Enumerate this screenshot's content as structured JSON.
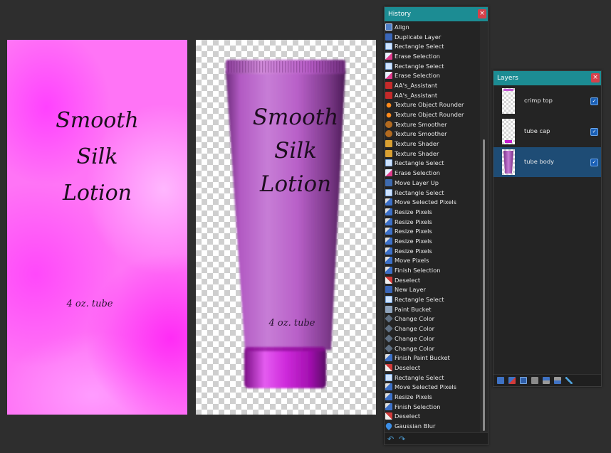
{
  "label_canvas": {
    "title": "Smooth\nSilk\nLotion",
    "size_text": "4 oz. tube"
  },
  "tube_canvas": {
    "title": "Smooth\nSilk\nLotion",
    "size_text": "4 oz. tube",
    "colors": {
      "tube": "#b554c4",
      "cap": "#c51bd0",
      "crimp": "#c15ad0"
    }
  },
  "history": {
    "title": "History",
    "close_symbol": "×",
    "undo_symbol": "↶",
    "redo_symbol": "↷",
    "items": [
      {
        "label": "Align",
        "icon": "align"
      },
      {
        "label": "Duplicate Layer",
        "icon": "dup"
      },
      {
        "label": "Rectangle Select",
        "icon": "rect"
      },
      {
        "label": "Erase Selection",
        "icon": "erase"
      },
      {
        "label": "Rectangle Select",
        "icon": "rect"
      },
      {
        "label": "Erase Selection",
        "icon": "erase"
      },
      {
        "label": "AA's_Assistant",
        "icon": "aa"
      },
      {
        "label": "AA's_Assistant",
        "icon": "aa"
      },
      {
        "label": "Texture Object Rounder",
        "icon": "rounder"
      },
      {
        "label": "Texture Object Rounder",
        "icon": "rounder"
      },
      {
        "label": "Texture Smoother",
        "icon": "smoother"
      },
      {
        "label": "Texture Smoother",
        "icon": "smoother"
      },
      {
        "label": "Texture Shader",
        "icon": "shader"
      },
      {
        "label": "Texture Shader",
        "icon": "shader"
      },
      {
        "label": "Rectangle Select",
        "icon": "rect"
      },
      {
        "label": "Erase Selection",
        "icon": "erase"
      },
      {
        "label": "Move Layer Up",
        "icon": "move"
      },
      {
        "label": "Rectangle Select",
        "icon": "rect"
      },
      {
        "label": "Move Selected Pixels",
        "icon": "arrow"
      },
      {
        "label": "Resize Pixels",
        "icon": "arrow"
      },
      {
        "label": "Resize Pixels",
        "icon": "arrow"
      },
      {
        "label": "Resize Pixels",
        "icon": "arrow"
      },
      {
        "label": "Resize Pixels",
        "icon": "arrow"
      },
      {
        "label": "Resize Pixels",
        "icon": "arrow"
      },
      {
        "label": "Move Pixels",
        "icon": "arrow"
      },
      {
        "label": "Finish Selection",
        "icon": "arrow"
      },
      {
        "label": "Deselect",
        "icon": "deselect"
      },
      {
        "label": "New Layer",
        "icon": "new"
      },
      {
        "label": "Rectangle Select",
        "icon": "rect"
      },
      {
        "label": "Paint Bucket",
        "icon": "bucket"
      },
      {
        "label": "Change Color",
        "icon": "color"
      },
      {
        "label": "Change Color",
        "icon": "color"
      },
      {
        "label": "Change Color",
        "icon": "color"
      },
      {
        "label": "Change Color",
        "icon": "color"
      },
      {
        "label": "Finish Paint Bucket",
        "icon": "arrow"
      },
      {
        "label": "Deselect",
        "icon": "deselect"
      },
      {
        "label": "Rectangle Select",
        "icon": "rect"
      },
      {
        "label": "Move Selected Pixels",
        "icon": "arrow"
      },
      {
        "label": "Resize Pixels",
        "icon": "arrow"
      },
      {
        "label": "Finish Selection",
        "icon": "arrow"
      },
      {
        "label": "Deselect",
        "icon": "deselect"
      },
      {
        "label": "Gaussian Blur",
        "icon": "blur"
      }
    ]
  },
  "layers": {
    "title": "Layers",
    "close_symbol": "×",
    "check_symbol": "✓",
    "items": [
      {
        "name": "crimp top",
        "visible": true,
        "selected": false
      },
      {
        "name": "tube cap",
        "visible": true,
        "selected": false
      },
      {
        "name": "tube body",
        "visible": true,
        "selected": true
      }
    ],
    "footer_icons": [
      "add-layer-icon",
      "delete-layer-icon",
      "duplicate-layer-icon",
      "merge-layer-icon",
      "move-layer-up-icon",
      "move-layer-down-icon",
      "layer-properties-icon"
    ]
  }
}
